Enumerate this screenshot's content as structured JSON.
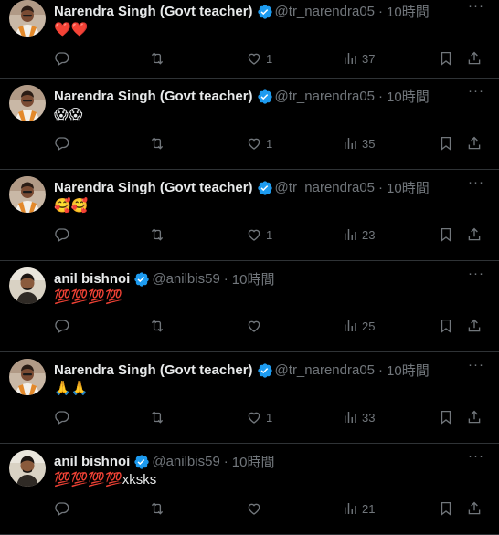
{
  "colors": {
    "background": "#000000",
    "text": "#e7e9ea",
    "muted": "#71767b",
    "verified": "#1d9bf0",
    "divider": "#2f3336"
  },
  "tweets": [
    {
      "name": "Narendra Singh (Govt teacher)",
      "handle": "@tr_narendra05",
      "dot": "·",
      "time": "10時間",
      "text": "❤️❤️",
      "likes": "1",
      "views": "37",
      "avatar": "narendra"
    },
    {
      "name": "Narendra Singh (Govt teacher)",
      "handle": "@tr_narendra05",
      "dot": "·",
      "time": "10時間",
      "text": "😱😱",
      "likes": "1",
      "views": "35",
      "avatar": "narendra"
    },
    {
      "name": "Narendra Singh (Govt teacher)",
      "handle": "@tr_narendra05",
      "dot": "·",
      "time": "10時間",
      "text": "🥰🥰",
      "likes": "1",
      "views": "23",
      "avatar": "narendra"
    },
    {
      "name": "anil bishnoi",
      "handle": "@anilbis59",
      "dot": "·",
      "time": "10時間",
      "text": "💯💯💯💯",
      "likes": "",
      "views": "25",
      "avatar": "anil"
    },
    {
      "name": "Narendra Singh (Govt teacher)",
      "handle": "@tr_narendra05",
      "dot": "·",
      "time": "10時間",
      "text": "🙏🙏",
      "likes": "1",
      "views": "33",
      "avatar": "narendra"
    },
    {
      "name": "anil bishnoi",
      "handle": "@anilbis59",
      "dot": "·",
      "time": "10時間",
      "text": "💯💯💯💯xksks",
      "likes": "",
      "views": "21",
      "avatar": "anil"
    }
  ],
  "icons": {
    "more": "more-dots-icon",
    "reply": "reply-icon",
    "retweet": "retweet-icon",
    "like": "like-icon",
    "views": "views-icon",
    "bookmark": "bookmark-icon",
    "share": "share-icon"
  }
}
